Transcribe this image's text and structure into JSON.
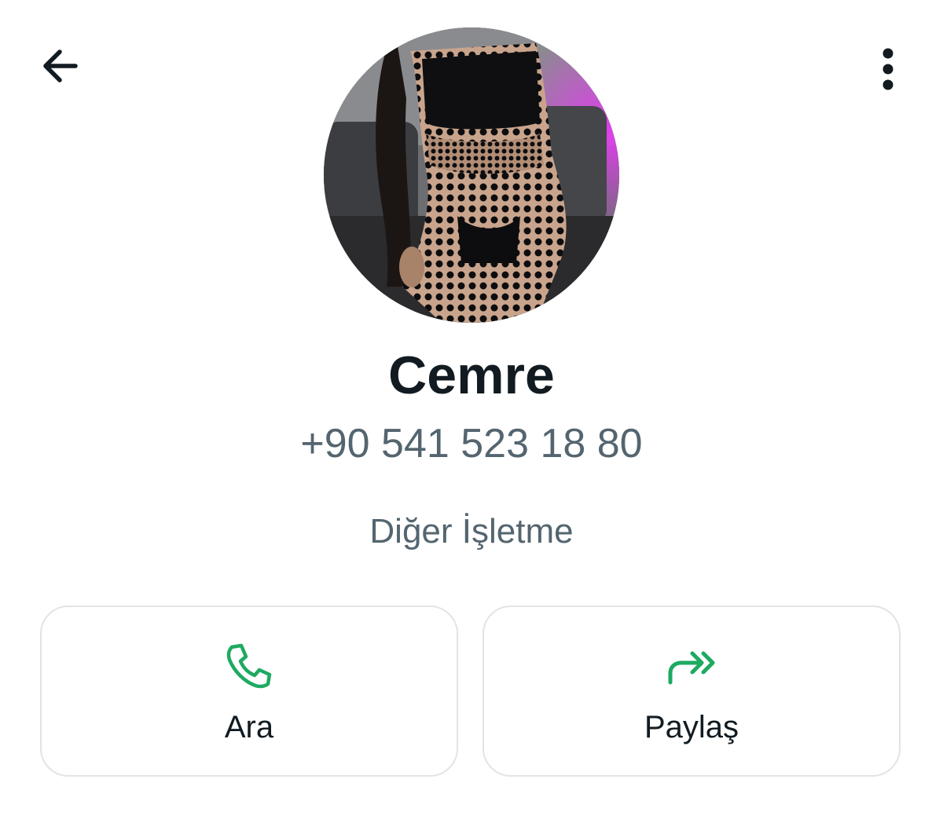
{
  "header": {
    "back_icon": "arrow-left-icon",
    "menu_icon": "more-vertical-icon"
  },
  "profile": {
    "name": "Cemre",
    "phone": "+90 541 523 18 80",
    "category": "Diğer İşletme"
  },
  "actions": [
    {
      "label": "Ara",
      "icon": "phone-icon"
    },
    {
      "label": "Paylaş",
      "icon": "forward-icon"
    }
  ],
  "colors": {
    "text_primary": "#111b21",
    "text_secondary": "#54656f",
    "accent_green": "#1daa61",
    "card_border": "#e2e4e5"
  }
}
